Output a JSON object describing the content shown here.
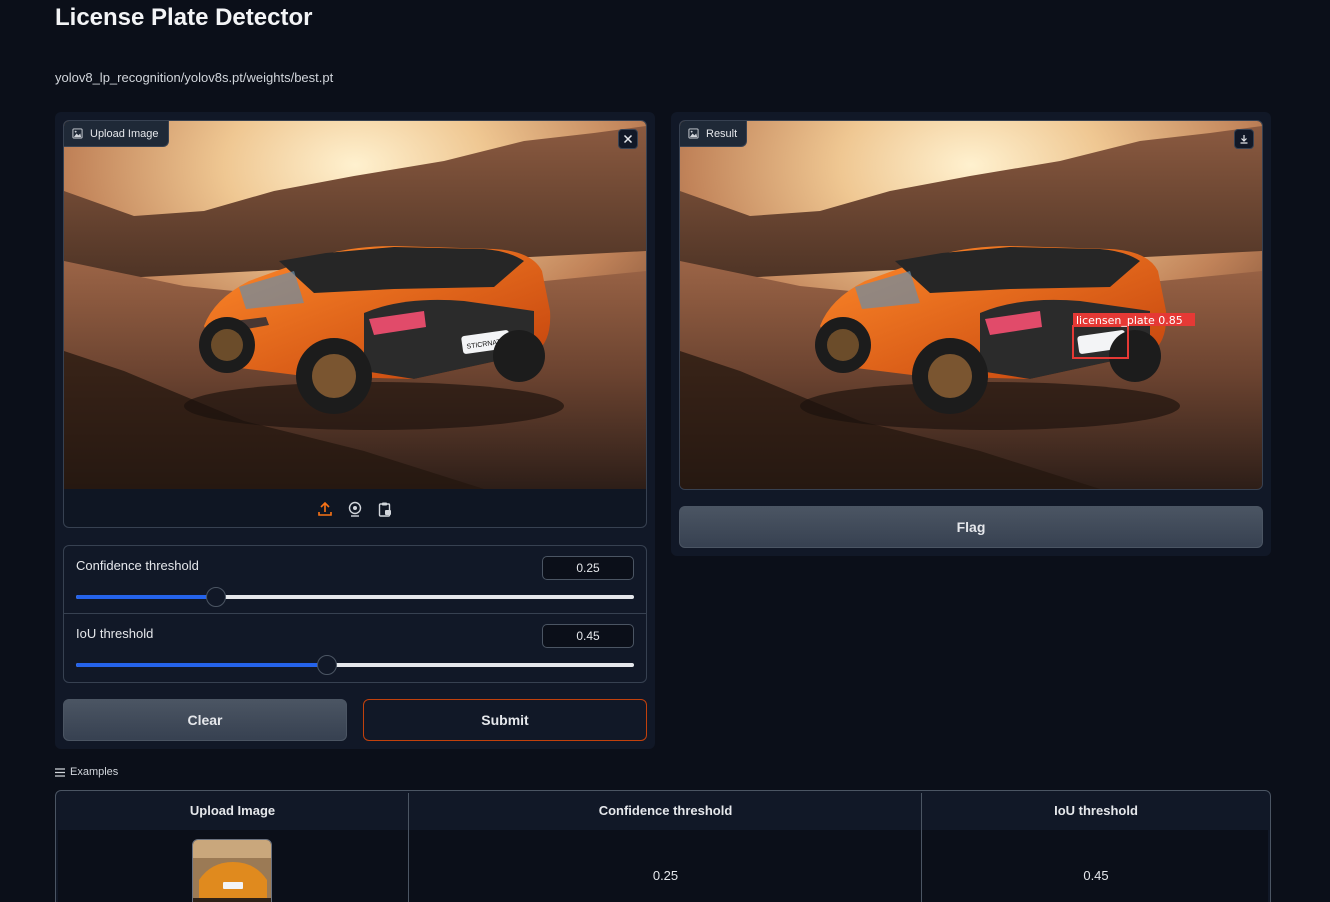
{
  "page": {
    "title": "License Plate Detector",
    "model_path": "yolov8_lp_recognition/yolov8s.pt/weights/best.pt"
  },
  "input": {
    "image_label": "Upload Image",
    "clear_icon": "close-icon",
    "source_icons": [
      "upload-icon",
      "webcam-icon",
      "clipboard-icon"
    ],
    "plate_text": "STICRNATO"
  },
  "output": {
    "image_label": "Result",
    "download_icon": "download-icon",
    "detection_label": "licensen_plate 0.85",
    "detection_color": "#e53935",
    "flag_label": "Flag"
  },
  "sliders": {
    "confidence": {
      "label": "Confidence threshold",
      "value": "0.25",
      "fraction": 0.25
    },
    "iou": {
      "label": "IoU threshold",
      "value": "0.45",
      "fraction": 0.45
    }
  },
  "buttons": {
    "clear": "Clear",
    "submit": "Submit"
  },
  "examples": {
    "title": "Examples",
    "headers": [
      "Upload Image",
      "Confidence threshold",
      "IoU threshold"
    ],
    "rows": [
      {
        "confidence": "0.25",
        "iou": "0.45"
      }
    ]
  },
  "colors": {
    "background": "#0b0f19",
    "panel": "#111827",
    "accent_blue": "#2563eb",
    "submit_border": "#c2410c"
  }
}
